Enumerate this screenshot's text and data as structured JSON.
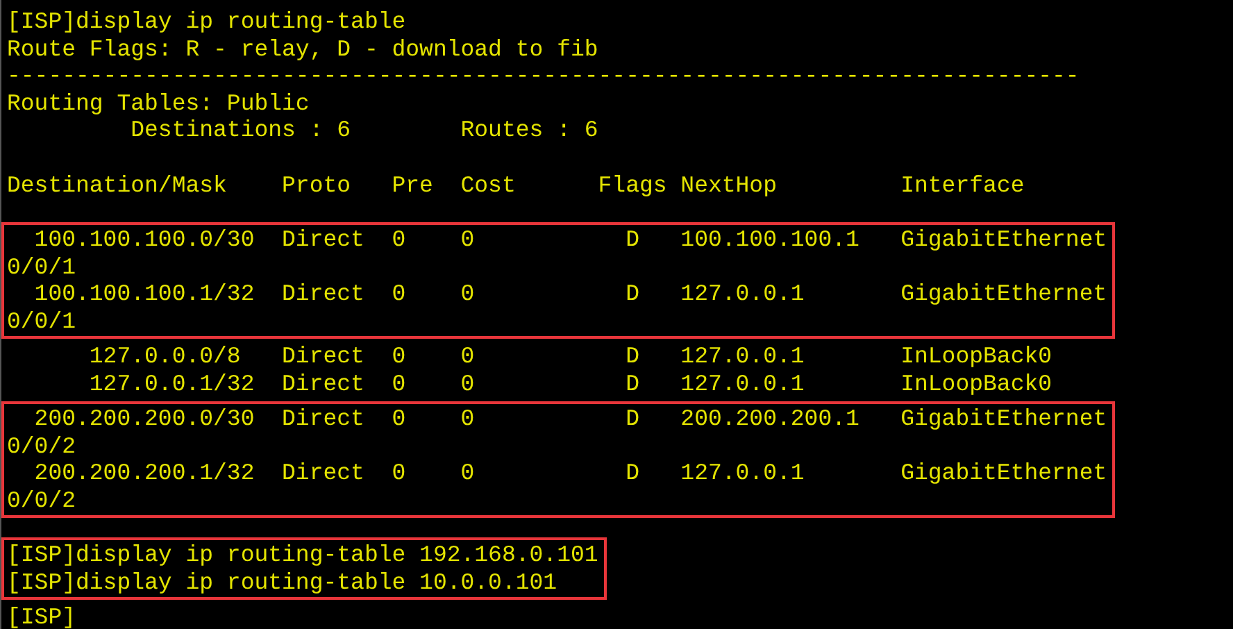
{
  "terminal": {
    "blocks": [
      {
        "highlighted": false,
        "lines": [
          "[ISP]display ip routing-table",
          "Route Flags: R - relay, D - download to fib",
          "------------------------------------------------------------------------------",
          "Routing Tables: Public",
          "         Destinations : 6        Routes : 6"
        ]
      },
      {
        "spaced": true,
        "highlighted": false,
        "lines": [
          "Destination/Mask    Proto   Pre  Cost      Flags NextHop         Interface"
        ]
      },
      {
        "spaced": true,
        "highlighted": true,
        "lines": [
          "  100.100.100.0/30  Direct  0    0           D   100.100.100.1   GigabitEthernet",
          "0/0/1",
          "  100.100.100.1/32  Direct  0    0           D   127.0.0.1       GigabitEthernet",
          "0/0/1"
        ]
      },
      {
        "highlighted": false,
        "lines": [
          "      127.0.0.0/8   Direct  0    0           D   127.0.0.1       InLoopBack0",
          "      127.0.0.1/32  Direct  0    0           D   127.0.0.1       InLoopBack0"
        ]
      },
      {
        "highlighted": true,
        "lines": [
          "  200.200.200.0/30  Direct  0    0           D   200.200.200.1   GigabitEthernet",
          "0/0/2",
          "  200.200.200.1/32  Direct  0    0           D   127.0.0.1       GigabitEthernet",
          "0/0/2"
        ]
      },
      {
        "spaced": true,
        "highlighted": true,
        "lines": [
          "[ISP]display ip routing-table 192.168.0.101",
          "[ISP]display ip routing-table 10.0.0.101"
        ]
      },
      {
        "highlighted": false,
        "lines": [
          "[ISP]"
        ]
      }
    ]
  }
}
